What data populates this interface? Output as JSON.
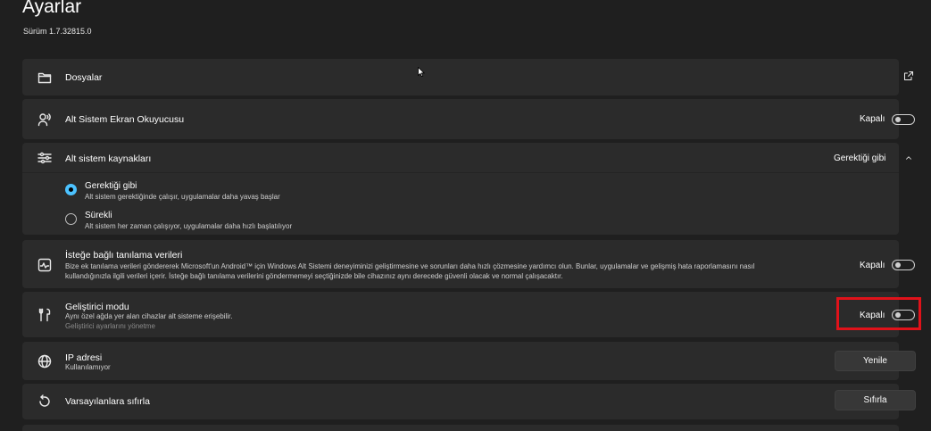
{
  "header": {
    "title": "Ayarlar",
    "version": "Sürüm 1.7.32815.0"
  },
  "files": {
    "label": "Dosyalar"
  },
  "screen_reader": {
    "label": "Alt Sistem Ekran Okuyucusu",
    "state": "Kapalı"
  },
  "resources": {
    "label": "Alt sistem kaynakları",
    "selected": "Gerektiği gibi",
    "options": [
      {
        "title": "Gerektiği gibi",
        "desc": "Alt sistem gerektiğinde çalışır, uygulamalar daha yavaş başlar"
      },
      {
        "title": "Sürekli",
        "desc": "Alt sistem her zaman çalışıyor, uygulamalar daha hızlı başlatılıyor"
      }
    ]
  },
  "diagnostics": {
    "label": "İsteğe bağlı tanılama verileri",
    "desc_line1": "Bize ek tanılama verileri göndererek Microsoft'un Android™ için Windows Alt Sistemi deneyiminizi geliştirmesine ve sorunları daha hızlı çözmesine yardımcı olun. Bunlar, uygulamalar ve gelişmiş hata raporlamasını nasıl",
    "desc_line2": "kullandığınızla ilgili verileri içerir. İsteğe bağlı tanılama verilerini göndermemeyi seçtiğinizde bile cihazınız aynı derecede güvenli olacak ve normal çalışacaktır.",
    "state": "Kapalı"
  },
  "developer": {
    "label": "Geliştirici modu",
    "desc": "Aynı özel ağda yer alan cihazlar alt sisteme erişebilir.",
    "link": "Geliştirici ayarlarını yönetme",
    "state": "Kapalı"
  },
  "ip": {
    "label": "IP adresi",
    "desc": "Kullanılamıyor",
    "button": "Yenile"
  },
  "reset": {
    "label": "Varsayılanlara sıfırla",
    "button": "Sıfırla"
  },
  "icons": {
    "files": "folder-icon",
    "screen_reader": "person-voice-icon",
    "resources": "sliders-icon",
    "diagnostics": "activity-icon",
    "developer": "tools-icon",
    "ip": "globe-icon",
    "reset": "reset-icon"
  },
  "colors": {
    "accent": "#4cc2ff",
    "highlight": "#e0121a",
    "card": "#2b2b2b",
    "background": "#1f1f1f"
  }
}
